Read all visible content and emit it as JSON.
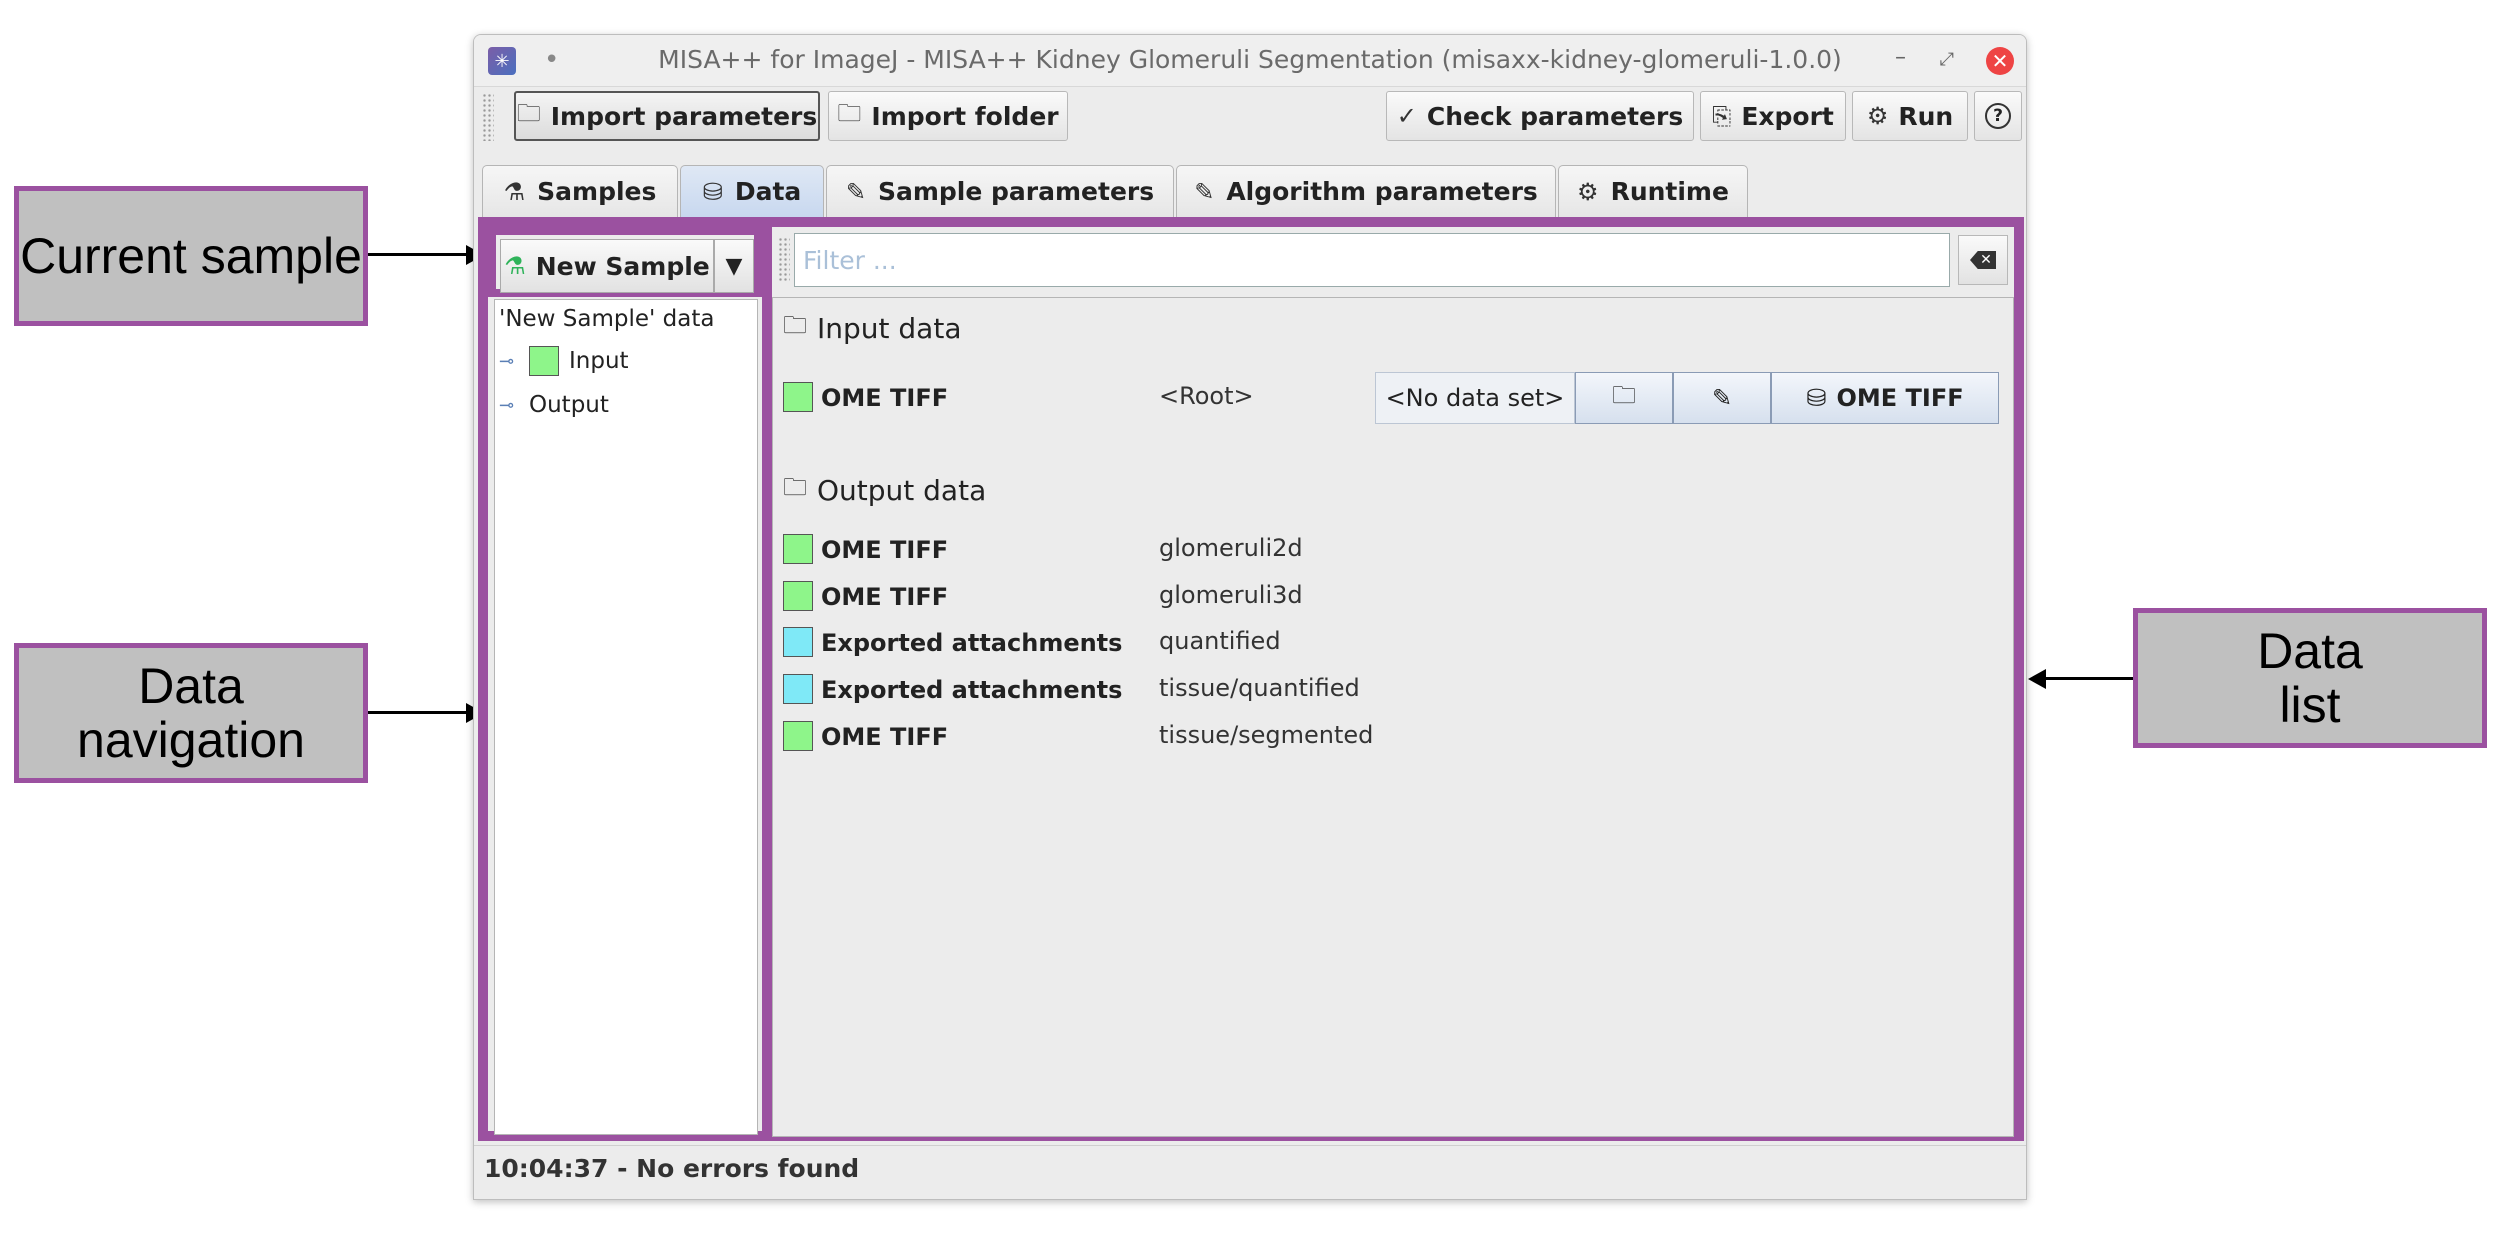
{
  "window": {
    "title": "MISA++ for ImageJ - MISA++ Kidney Glomeruli Segmentation (misaxx-kidney-glomeruli-1.0.0)",
    "app_icon": "misa-icon",
    "dot": "•",
    "minimize": "–",
    "restore": "⤢",
    "close": "✕"
  },
  "toolbar": {
    "import_parameters": "Import parameters",
    "import_folder": "Import folder",
    "check_parameters": "Check parameters",
    "export": "Export",
    "run": "Run",
    "help": "?"
  },
  "tabs": [
    {
      "label": "Samples",
      "icon": "flask-icon"
    },
    {
      "label": "Data",
      "icon": "database-icon"
    },
    {
      "label": "Sample parameters",
      "icon": "pencil-icon"
    },
    {
      "label": "Algorithm parameters",
      "icon": "pencil-icon"
    },
    {
      "label": "Runtime",
      "icon": "gear-icon"
    }
  ],
  "sample": {
    "current": "New Sample"
  },
  "tree": {
    "root": "'New Sample' data",
    "items": [
      "Input",
      "Output"
    ]
  },
  "filter": {
    "placeholder": "Filter ..."
  },
  "input_section": {
    "title": "Input data",
    "rows": [
      {
        "type": "OME TIFF",
        "path": "<Root>",
        "color": "#8ef58a"
      }
    ],
    "no_data": "<No data set>",
    "data_button": "OME TIFF"
  },
  "output_section": {
    "title": "Output data",
    "rows": [
      {
        "type": "OME TIFF",
        "path": "glomeruli2d",
        "color": "#8ef58a"
      },
      {
        "type": "OME TIFF",
        "path": "glomeruli3d",
        "color": "#8ef58a"
      },
      {
        "type": "Exported attachments",
        "path": "quantified",
        "color": "#7fe9f7"
      },
      {
        "type": "Exported attachments",
        "path": "tissue/quantified",
        "color": "#7fe9f7"
      },
      {
        "type": "OME TIFF",
        "path": "tissue/segmented",
        "color": "#8ef58a"
      }
    ]
  },
  "status": "10:04:37 - No errors found",
  "callouts": {
    "current_sample": "Current sample",
    "data_navigation_1": "Data",
    "data_navigation_2": "navigation",
    "data_list_1": "Data",
    "data_list_2": "list"
  },
  "colors": {
    "highlight": "#9b51a0",
    "input_swatch": "#8ef58a",
    "attachment_swatch": "#7fe9f7"
  }
}
